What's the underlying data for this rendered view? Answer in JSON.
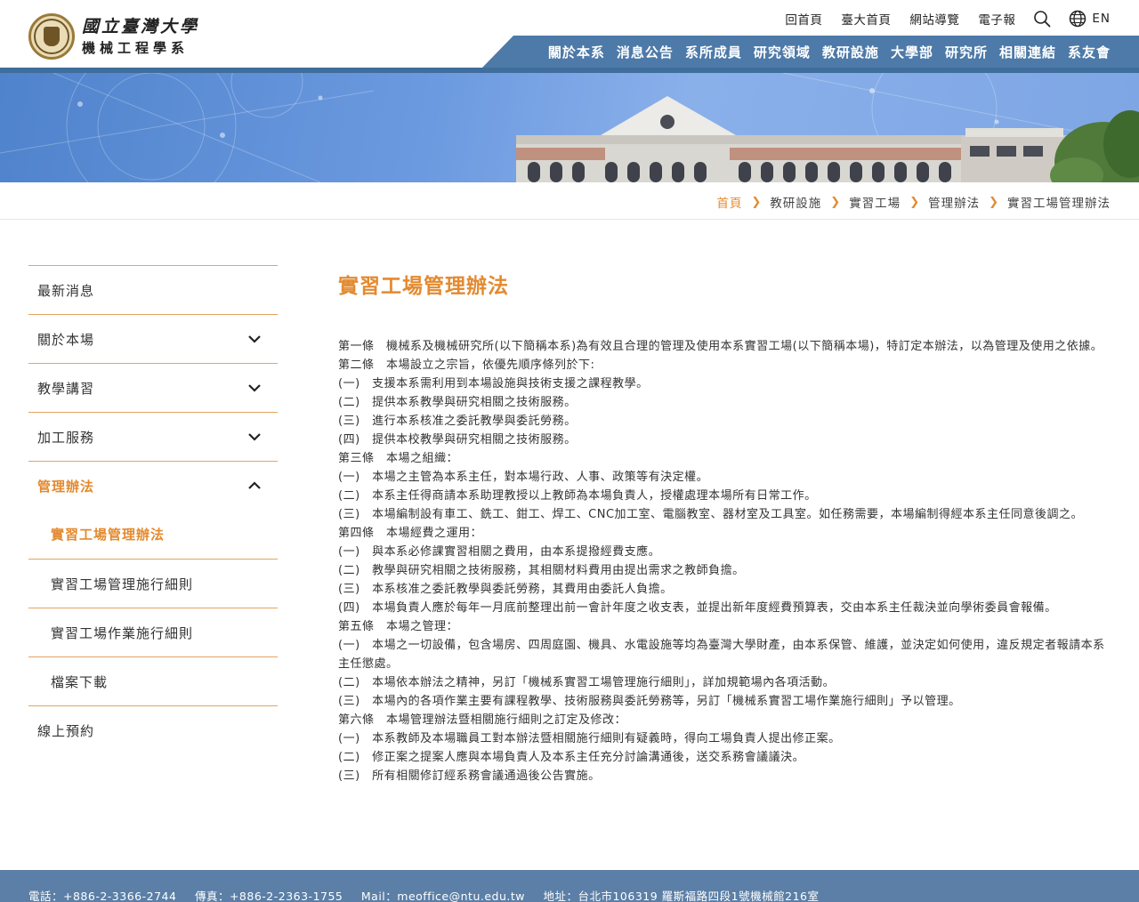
{
  "header": {
    "logo_line1": "國立臺灣大學",
    "logo_line2": "機械工程學系",
    "top_links": [
      "回首頁",
      "臺大首頁",
      "網站導覽",
      "電子報"
    ],
    "lang_label": "EN"
  },
  "nav": [
    "關於本系",
    "消息公告",
    "系所成員",
    "研究領域",
    "教研設施",
    "大學部",
    "研究所",
    "相關連結",
    "系友會"
  ],
  "breadcrumb": [
    "首頁",
    "教研設施",
    "實習工場",
    "管理辦法",
    "實習工場管理辦法"
  ],
  "sidebar": {
    "items": [
      {
        "label": "最新消息"
      },
      {
        "label": "關於本場"
      },
      {
        "label": "教學講習"
      },
      {
        "label": "加工服務"
      },
      {
        "label": "管理辦法"
      }
    ],
    "sub_items": [
      {
        "label": "實習工場管理辦法"
      },
      {
        "label": "實習工場管理施行細則"
      },
      {
        "label": "實習工場作業施行細則"
      },
      {
        "label": "檔案下載"
      }
    ],
    "last_item": {
      "label": "線上預約"
    }
  },
  "main": {
    "title": "實習工場管理辦法",
    "paragraphs": [
      "第一條　機械系及機械研究所(以下簡稱本系)為有效且合理的管理及使用本系實習工場(以下簡稱本場)，特訂定本辦法，以為管理及使用之依據。",
      "第二條　本場設立之宗旨，依優先順序條列於下:",
      "(一)　支援本系需利用到本場設施與技術支援之課程教學。",
      "(二)　提供本系教學與研究相關之技術服務。",
      "(三)　進行本系核准之委託教學與委託勞務。",
      "(四)　提供本校教學與研究相關之技術服務。",
      "第三條　本場之組織：",
      "(一)　本場之主管為本系主任，對本場行政、人事、政策等有決定權。",
      "(二)　本系主任得商請本系助理教授以上教師為本場負責人，授權處理本場所有日常工作。",
      "(三)　本場編制設有車工、銑工、鉗工、焊工、CNC加工室、電腦教室、器材室及工具室。如任務需要，本場編制得經本系主任同意後調之。",
      "第四條　本場經費之運用：",
      "(一)　與本系必修課實習相關之費用，由本系提撥經費支應。",
      "(二)　教學與研究相關之技術服務，其相關材料費用由提出需求之教師負擔。",
      "(三)　本系核准之委託教學與委託勞務，其費用由委託人負擔。",
      "(四)　本場負責人應於每年一月底前整理出前一會計年度之收支表，並提出新年度經費預算表，交由本系主任裁決並向學術委員會報備。",
      "第五條　本場之管理：",
      "(一)　本場之一切設備，包含場房、四周庭園、機具、水電設施等均為臺灣大學財產，由本系保管、維護，並決定如何使用，違反規定者報請本系主任懲處。",
      "(二)　本場依本辦法之精神，另訂「機械系實習工場管理施行細則」，詳加規範場內各項活動。",
      "(三)　本場內的各項作業主要有課程教學、技術服務與委託勞務等，另訂「機械系實習工場作業施行細則」予以管理。",
      "第六條　本場管理辦法暨相關施行細則之訂定及修改：",
      "(一)　本系教師及本場職員工對本辦法暨相關施行細則有疑義時，得向工場負責人提出修正案。",
      "(二)　修正案之提案人應與本場負責人及本系主任充分討論溝通後，送交系務會議議決。",
      "(三)　所有相關修訂經系務會議通過後公告實施。"
    ]
  },
  "footer": {
    "phone": "電話：+886-2-3366-2744",
    "fax": "傳真：+886-2-2363-1755",
    "mail": "Mail：meoffice@ntu.edu.tw",
    "address": "地址：台北市106319 羅斯福路四段1號機械館216室"
  },
  "colors": {
    "accent": "#e38a2f",
    "nav": "#4d7aa8",
    "footer": "#5b7fa6"
  }
}
